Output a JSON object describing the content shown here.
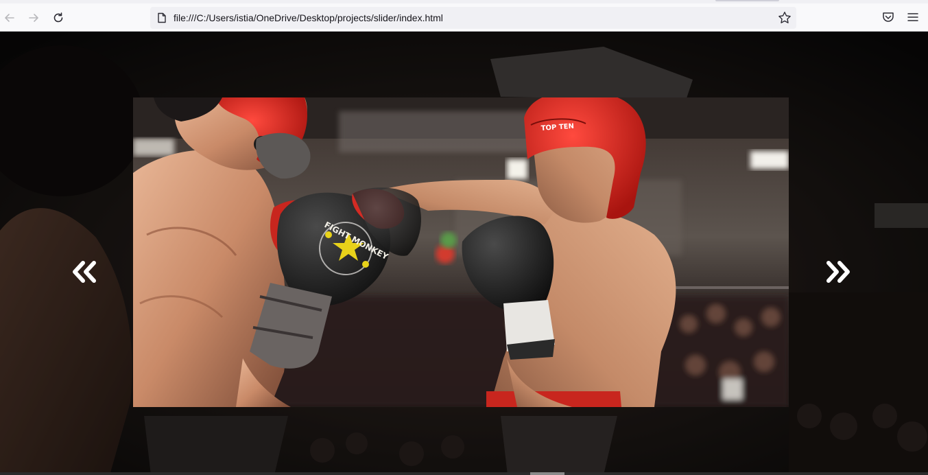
{
  "browser": {
    "url": "file:///C:/Users/istia/OneDrive/Desktop/projects/slider/index.html",
    "icons": {
      "back": "arrow-left-icon",
      "forward": "arrow-right-icon",
      "reload": "reload-icon",
      "page": "page-icon",
      "bookmark": "star-icon",
      "pocket": "pocket-icon",
      "menu": "hamburger-menu-icon"
    }
  },
  "slider": {
    "prev_icon": "double-chevron-left-icon",
    "next_icon": "double-chevron-right-icon",
    "image": "boxing-match-photo",
    "glove_text": "FIGHT MONKEY",
    "helmet_text": "TOP TEN"
  },
  "colors": {
    "helmet_red": "#d42b24",
    "glove_black": "#1c1c1c",
    "star_yellow": "#e8d21a",
    "arrow_white": "#ffffff"
  }
}
